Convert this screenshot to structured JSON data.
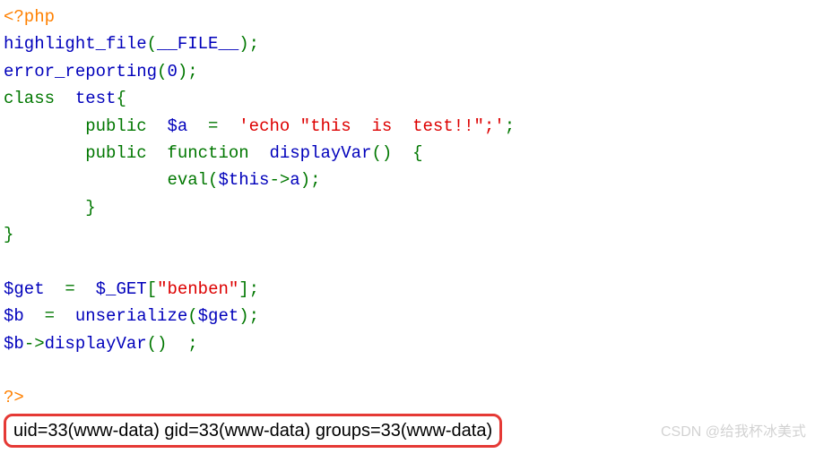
{
  "code": {
    "open_tag": "<?php",
    "l2": {
      "fn": "highlight_file",
      "p1": "(",
      "arg": "__FILE__",
      "p2": ");"
    },
    "l3": {
      "fn": "error_reporting",
      "p1": "(",
      "arg": "0",
      "p2": ");"
    },
    "l4": {
      "kw": "class  ",
      "name": "test",
      "brace": "{"
    },
    "l5": {
      "indent": "        ",
      "kw": "public  ",
      "var": "$a  ",
      "eq": "=  ",
      "str": "'echo \"this  is  test!!\";'",
      "semi": ";"
    },
    "l6": {
      "indent": "        ",
      "kw": "public  function  ",
      "name": "displayVar",
      "p": "()  {"
    },
    "l7": {
      "indent": "                ",
      "fn": "eval(",
      "this": "$this",
      "arrow": "->",
      "prop": "a",
      "close": ");"
    },
    "l8": {
      "indent": "        ",
      "brace": "}"
    },
    "l9": {
      "brace": "}"
    },
    "l11": {
      "var": "$get  ",
      "eq": "=  ",
      "glob": "$_GET",
      "b1": "[",
      "key": "\"benben\"",
      "b2": "];"
    },
    "l12": {
      "var": "$b  ",
      "eq": "=  ",
      "fn": "unserialize",
      "p1": "(",
      "arg": "$get",
      "p2": ");"
    },
    "l13": {
      "var": "$b",
      "arrow": "->",
      "call": "displayVar",
      "p": "()  ;"
    },
    "close_tag": "?>"
  },
  "output": "uid=33(www-data) gid=33(www-data) groups=33(www-data)",
  "watermark": "CSDN @给我杯冰美式"
}
